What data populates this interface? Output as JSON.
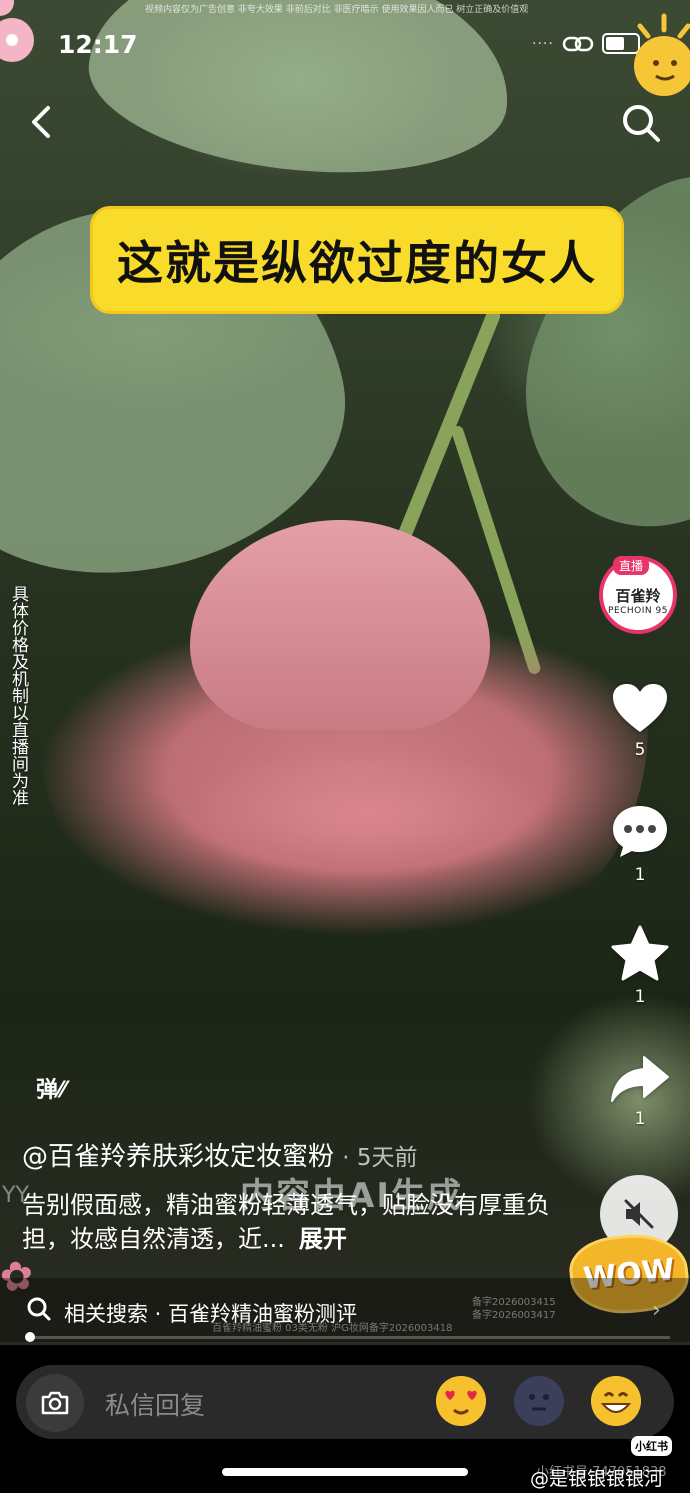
{
  "status_bar": {
    "time": "12:17",
    "disclaimer": "视频内容仅为广告创意 非夸大效果 非前后对比 非医疗暗示 使用效果因人而已 树立正确及价值观"
  },
  "nav": {
    "back_icon": "chevron-left-icon",
    "search_icon": "search-icon"
  },
  "video": {
    "title_banner": "这就是纵欲过度的女人",
    "side_note": "具体价格及机制以直播间为准",
    "ai_watermark": "内容由AI生成",
    "wow_sticker": "WOW",
    "faint_left_text": "YY"
  },
  "live": {
    "tag": "直播",
    "brand_cn": "百雀羚",
    "brand_en": "PECHOIN 95"
  },
  "actions": {
    "like_count": "5",
    "comment_count": "1",
    "favorite_count": "1",
    "share_count": "1"
  },
  "post": {
    "danmu_label": "弹",
    "author": "@百雀羚养肤彩妆定妆蜜粉",
    "age": "· 5天前",
    "description": "告别假面感，精油蜜粉轻薄透气，贴脸没有厚重负担，妆感自然清透，近...",
    "expand": "展开"
  },
  "related": {
    "text": "相关搜索 · 百雀羚精油蜜粉测评",
    "reg_line1": "备字2026003415",
    "reg_line2": "备字2026003417",
    "reg_line3": "百雀羚精油蜜粉 03类无粉 沪G妆网备字2026003418"
  },
  "reply": {
    "placeholder": "私信回复"
  },
  "watermark": {
    "xhs_badge": "小红书",
    "xhs_id": "小红书号 747051838",
    "weibo": "@是银银银银河"
  },
  "colors": {
    "banner": "#f9dc2b",
    "live_ring": "#e8346a",
    "wow": "#f3b52a"
  }
}
